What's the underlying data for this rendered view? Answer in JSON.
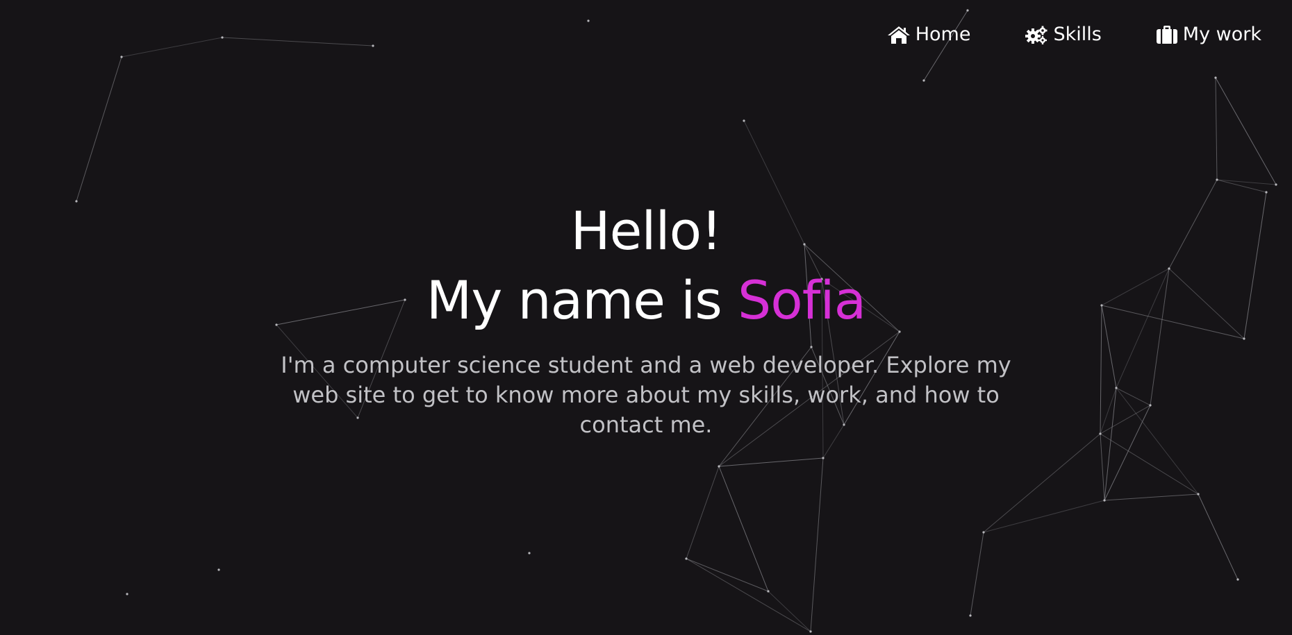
{
  "nav": {
    "items": [
      {
        "label": "Home",
        "icon": "home-icon"
      },
      {
        "label": "Skills",
        "icon": "gears-icon"
      },
      {
        "label": "My work",
        "icon": "briefcase-icon"
      }
    ]
  },
  "hero": {
    "greeting": "Hello!",
    "name_prefix": "My name is ",
    "name": "Sofia",
    "intro": "I'm a computer science student and a web developer. Explore my web site to get to know more about my skills, work, and how to contact me."
  },
  "colors": {
    "background": "#161417",
    "accent": "#d630d6",
    "text": "#ffffff",
    "muted_text": "#c2c2c6"
  }
}
